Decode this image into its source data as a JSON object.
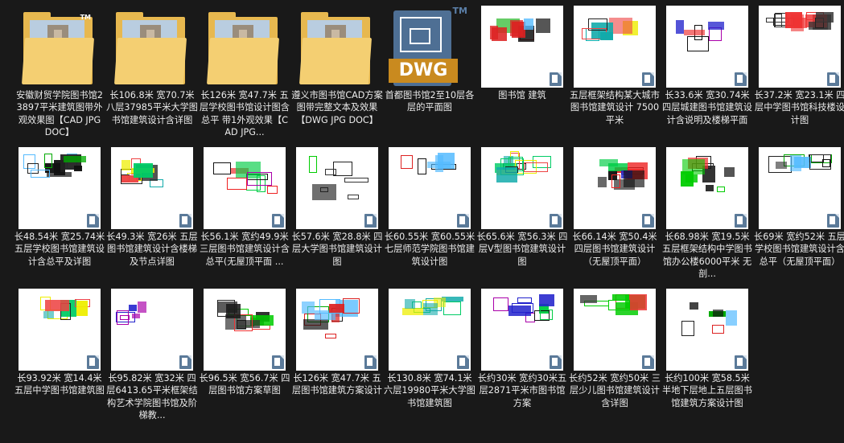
{
  "colors": {
    "background": "#191919",
    "caption_text": "#ececec",
    "folder": "#e7b84f",
    "dwg_blue": "#4e6f94",
    "dwg_orange": "#c98a1f",
    "badge": "#5b7a99"
  },
  "files": [
    {
      "kind": "folder",
      "icon": "folder-icon",
      "tm": "TM",
      "label": "安徽财贸学院图书馆23897平米建筑图带外观效果图【CAD JPG DOC】"
    },
    {
      "kind": "folder",
      "icon": "folder-icon",
      "tm": "",
      "label": "长106.8米 宽70.7米 八层37985平米大学图书馆建筑设计含详图"
    },
    {
      "kind": "folder",
      "icon": "folder-icon",
      "tm": "",
      "label": "长126米 宽47.7米 五层学校图书馆设计图含总平 带1外观效果【CAD JPG..."
    },
    {
      "kind": "folder",
      "icon": "folder-icon",
      "tm": "",
      "label": "遵义市图书馆CAD方案图带完整文本及效果【DWG JPG DOC】"
    },
    {
      "kind": "dwg",
      "icon": "dwg-file-icon",
      "dwg": "DWG",
      "tm": "TM",
      "label": "首都图书馆2至10层各层的平面图"
    },
    {
      "kind": "drawing",
      "icon": "cad-drawing-icon",
      "label": "图书馆 建筑"
    },
    {
      "kind": "drawing",
      "icon": "cad-drawing-icon",
      "label": "五层框架结构某大城市图书馆建筑设计 7500平米"
    },
    {
      "kind": "drawing",
      "icon": "cad-drawing-icon",
      "label": "长33.6米 宽30.74米 四层城建图书馆建筑设计含说明及楼梯平面"
    },
    {
      "kind": "drawing",
      "icon": "cad-drawing-icon",
      "label": "长37.2米 宽23.1米 四层中学图书馆科技楼设计图"
    },
    {
      "kind": "drawing",
      "icon": "cad-drawing-icon",
      "label": "长48.54米 宽25.74米 五层学校图书馆建筑设计含总平及详图"
    },
    {
      "kind": "drawing",
      "icon": "cad-drawing-icon",
      "label": "长49.3米 宽26米 五层图书馆建筑设计含楼梯及节点详图"
    },
    {
      "kind": "drawing",
      "icon": "cad-drawing-icon",
      "label": "长56.1米 宽约49.9米 三层图书馆建筑设计含总平(无屋顶平面 ..."
    },
    {
      "kind": "drawing",
      "icon": "cad-drawing-icon",
      "label": "长57.6米 宽28.8米 四层大学图书馆建筑设计图"
    },
    {
      "kind": "drawing",
      "icon": "cad-drawing-icon",
      "label": "长60.55米 宽60.55米 七层师范学院图书馆建筑设计图"
    },
    {
      "kind": "drawing",
      "icon": "cad-drawing-icon",
      "label": "长65.6米 宽56.3米 四层V型图书馆建筑设计图"
    },
    {
      "kind": "drawing",
      "icon": "cad-drawing-icon",
      "label": "长66.14米 宽50.4米 四层图书馆建筑设计（无屋顶平面）"
    },
    {
      "kind": "drawing",
      "icon": "cad-drawing-icon",
      "label": "长68.98米 宽19.5米 五层框架结构中学图书馆办公楼6000平米 无剖..."
    },
    {
      "kind": "drawing",
      "icon": "cad-drawing-icon",
      "label": "长69米 宽约52米 五层学校图书馆建筑设计含总平（无屋顶平面）"
    },
    {
      "kind": "drawing",
      "icon": "cad-drawing-icon",
      "label": "长93.92米 宽14.4米 五层中学图书馆建筑图"
    },
    {
      "kind": "drawing",
      "icon": "cad-drawing-icon",
      "label": "长95.82米 宽32米 四层6413.65平米框架结构艺术学院图书馆及阶梯教..."
    },
    {
      "kind": "drawing",
      "icon": "cad-drawing-icon",
      "label": "长96.5米 宽56.7米 四层图书馆方案草图"
    },
    {
      "kind": "drawing",
      "icon": "cad-drawing-icon",
      "label": "长126米 宽47.7米 五层图书馆建筑方案设计"
    },
    {
      "kind": "drawing",
      "icon": "cad-drawing-icon",
      "label": "长130.8米 宽74.1米 六层19980平米大学图书馆建筑图"
    },
    {
      "kind": "drawing",
      "icon": "cad-drawing-icon",
      "label": "长约30米 宽约30米五层2871平米市图书馆方案"
    },
    {
      "kind": "drawing",
      "icon": "cad-drawing-icon",
      "label": "长约52米 宽约50米 三层少儿图书馆建筑设计含详图"
    },
    {
      "kind": "drawing",
      "icon": "cad-drawing-icon",
      "label": "长约100米 宽58.5米 半地下层地上五层图书馆建筑方案设计图"
    }
  ]
}
